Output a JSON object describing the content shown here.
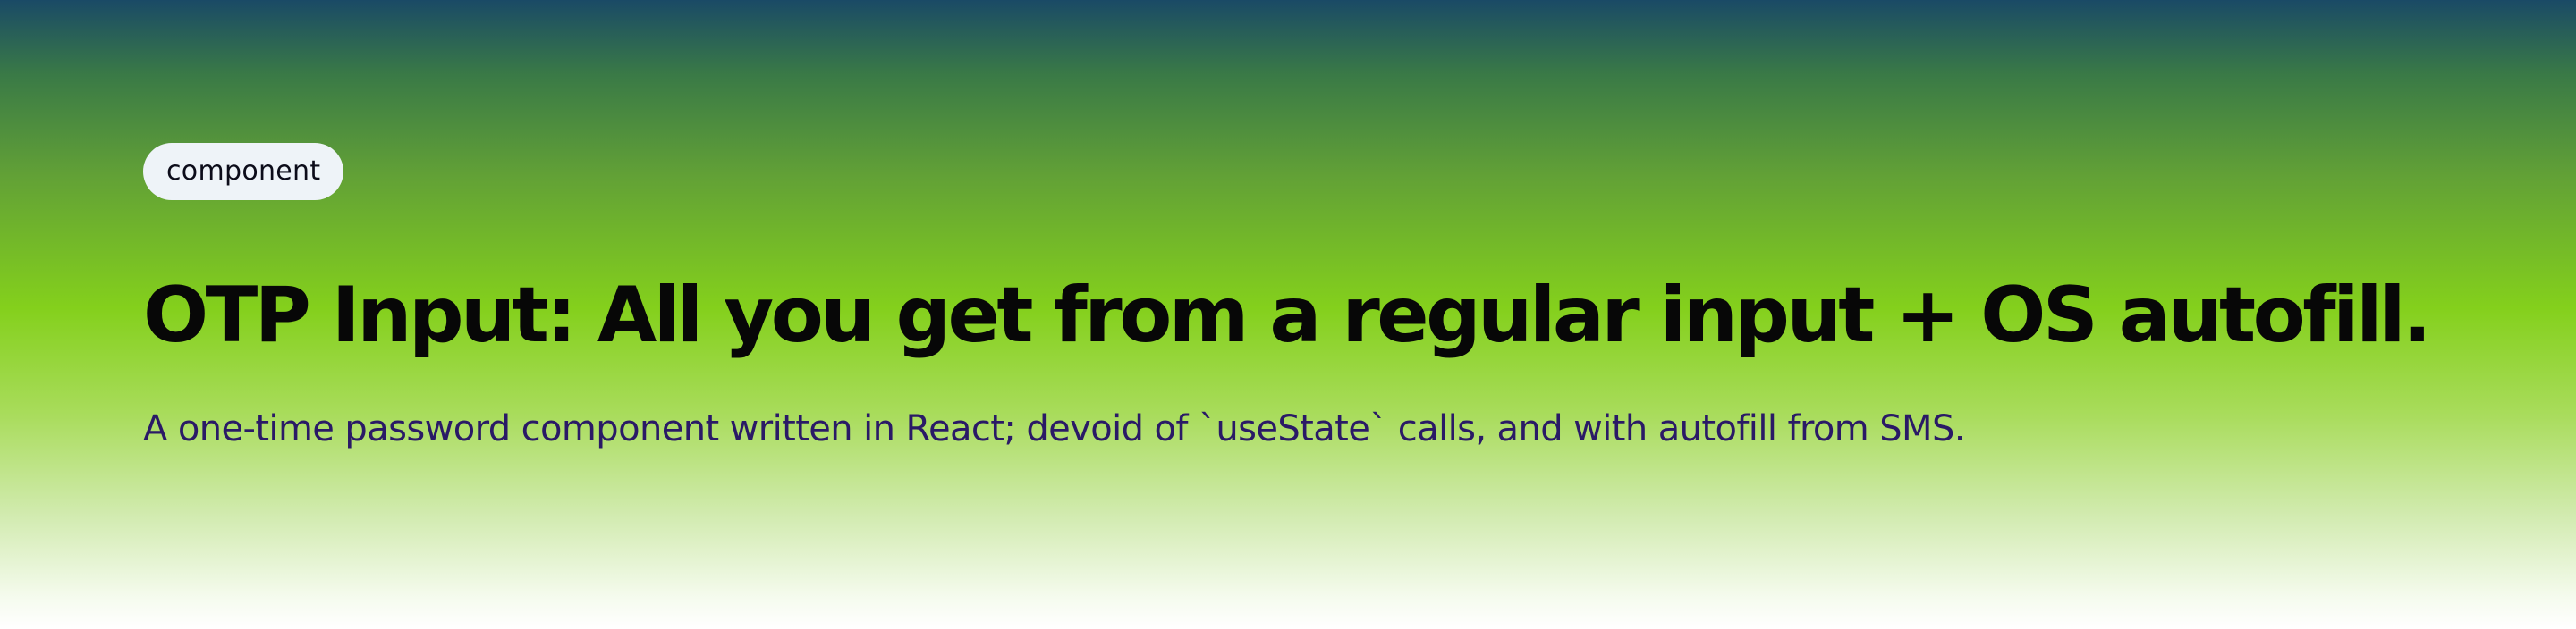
{
  "hero": {
    "badge": "component",
    "title": "OTP Input: All you get from a regular input + OS autofill.",
    "subtitle": "A one-time password component written in React; devoid of `useState` calls, and with autofill from SMS."
  },
  "colors": {
    "gradient_top": "#1a4a66",
    "gradient_mid": "#84d01c",
    "gradient_bottom": "#ffffff",
    "badge_background": "#eef3f8",
    "title_text": "#070707",
    "subtitle_text": "#2a1a66"
  }
}
